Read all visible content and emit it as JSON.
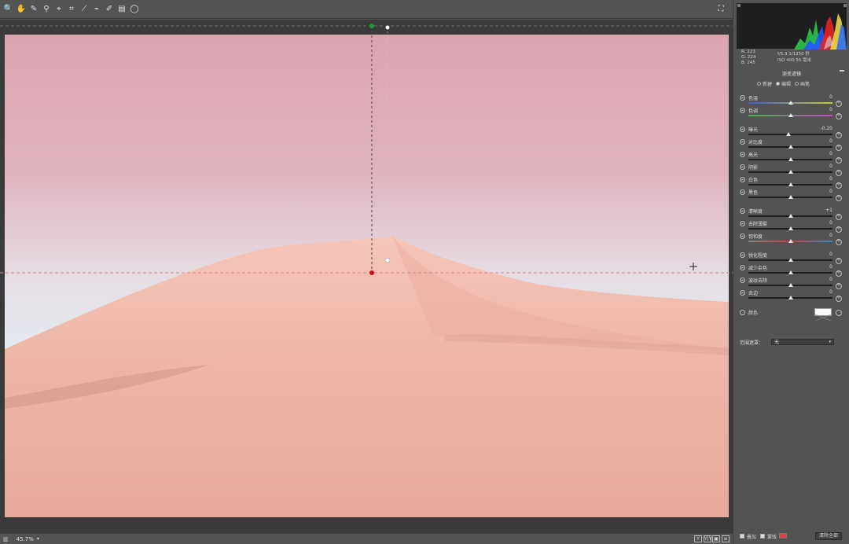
{
  "toolbar": {
    "tools": [
      {
        "name": "zoom-tool-icon",
        "glyph": "🔍"
      },
      {
        "name": "hand-tool-icon",
        "glyph": "✋"
      },
      {
        "name": "white-balance-tool-icon",
        "glyph": "✎"
      },
      {
        "name": "color-sampler-tool-icon",
        "glyph": "⚲"
      },
      {
        "name": "targeted-adjustment-tool-icon",
        "glyph": "⌖"
      },
      {
        "name": "crop-tool-icon",
        "glyph": "⌗"
      },
      {
        "name": "straighten-tool-icon",
        "glyph": "⟋"
      },
      {
        "name": "spot-removal-tool-icon",
        "glyph": "⌁"
      },
      {
        "name": "adjustment-brush-icon",
        "glyph": "✐"
      },
      {
        "name": "graduated-filter-icon",
        "glyph": "▤"
      },
      {
        "name": "radial-filter-icon",
        "glyph": "◯"
      }
    ],
    "right_icon": "fullscreen-icon"
  },
  "photo": {
    "colors": {
      "sky_top": "#dea6b2",
      "sky_mid": "#e8d4dc",
      "sky_bottom": "#e2f4fa",
      "dune": "#eeb4a4",
      "dune_shadow": "#d69a8e"
    }
  },
  "guides": {
    "line_color": "#e08080",
    "start_marker": "#1e9b36",
    "end_marker": "#c0141c"
  },
  "bottom": {
    "zoom": "45.7%",
    "view_buttons": [
      "Y",
      "Y|Y",
      "▣",
      "≡"
    ]
  },
  "panel": {
    "readout": {
      "r": "R:  223",
      "g": "G:  224",
      "b": "B:  245",
      "exposure": "f/5.3    1/1250 秒",
      "iso": "ISO 400    55 毫米"
    },
    "title": "渐变滤镜",
    "modes": [
      {
        "label": "新建",
        "selected": false
      },
      {
        "label": "编辑",
        "selected": true
      },
      {
        "label": "画笔",
        "selected": false
      }
    ],
    "sliders": [
      {
        "label": "色温",
        "value": "0",
        "pos": 0.5,
        "track": "temp"
      },
      {
        "label": "色调",
        "value": "0",
        "pos": 0.5,
        "track": "tint"
      },
      {
        "label": "曝光",
        "value": "-0.20",
        "pos": 0.48,
        "track": "plain"
      },
      {
        "label": "对比度",
        "value": "0",
        "pos": 0.5,
        "track": "plain"
      },
      {
        "label": "高光",
        "value": "0",
        "pos": 0.5,
        "track": "plain"
      },
      {
        "label": "阴影",
        "value": "0",
        "pos": 0.5,
        "track": "plain"
      },
      {
        "label": "白色",
        "value": "0",
        "pos": 0.5,
        "track": "plain"
      },
      {
        "label": "黑色",
        "value": "0",
        "pos": 0.5,
        "track": "plain"
      },
      {
        "label": "清晰度",
        "value": "+1",
        "pos": 0.5,
        "track": "plain"
      },
      {
        "label": "去除薄雾",
        "value": "0",
        "pos": 0.5,
        "track": "plain"
      },
      {
        "label": "饱和度",
        "value": "0",
        "pos": 0.5,
        "track": "sat"
      },
      {
        "label": "锐化程度",
        "value": "0",
        "pos": 0.5,
        "track": "plain"
      },
      {
        "label": "减少杂色",
        "value": "0",
        "pos": 0.5,
        "track": "plain"
      },
      {
        "label": "波纹去除",
        "value": "0",
        "pos": 0.5,
        "track": "plain"
      },
      {
        "label": "去边",
        "value": "0",
        "pos": 0.5,
        "track": "plain"
      }
    ],
    "color_label": "颜色",
    "range_label": "范围遮罩：",
    "range_value": "无",
    "footer": {
      "overlay_label": "叠加",
      "mask_label": "蒙版",
      "mask_color": "#e0404a",
      "clear_label": "清除全部"
    }
  }
}
